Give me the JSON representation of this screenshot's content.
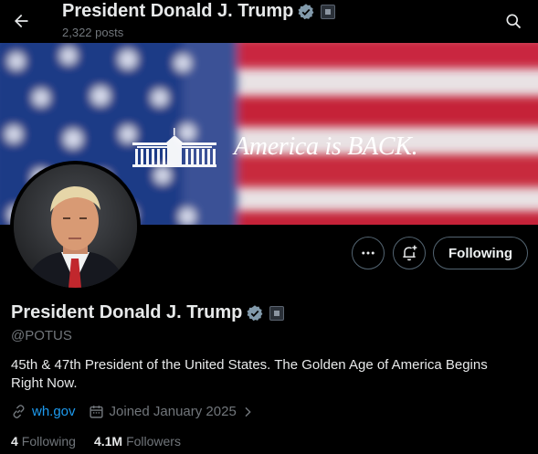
{
  "header": {
    "title": "President Donald J. Trump",
    "post_count": "2,322 posts",
    "back_icon": "arrow-left-icon",
    "search_icon": "search-icon"
  },
  "banner": {
    "slogan": "America is BACK."
  },
  "actions": {
    "more_icon": "more-icon",
    "notify_icon": "bell-plus-icon",
    "following_label": "Following"
  },
  "profile": {
    "name": "President Donald J. Trump",
    "handle": "@POTUS",
    "bio": "45th & 47th President of the United States. The Golden Age of America Begins Right Now.",
    "website": "wh.gov",
    "joined": "Joined January 2025",
    "following_count": "4",
    "following_label": "Following",
    "followers_count": "4.1M",
    "followers_label": "Followers"
  },
  "colors": {
    "background": "#000000",
    "text": "#e7e9ea",
    "muted": "#71767b",
    "link": "#1d9bf0",
    "verified": "#829aab",
    "border": "#536471"
  }
}
